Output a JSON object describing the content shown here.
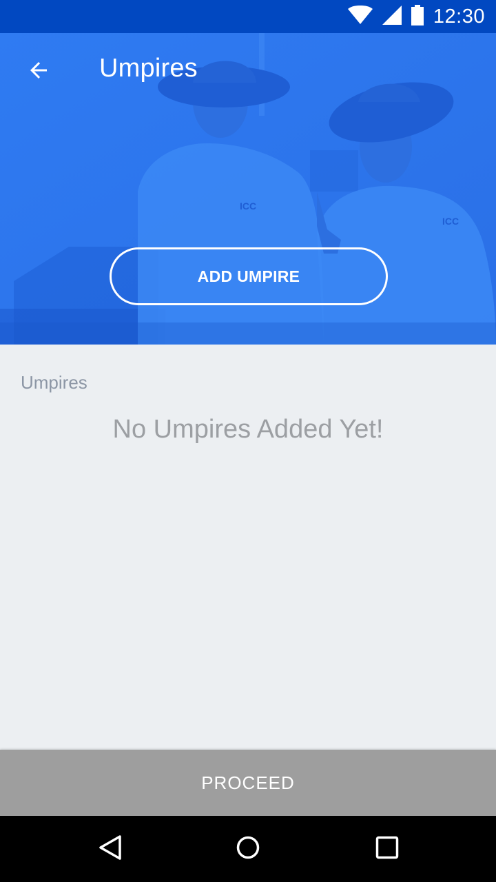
{
  "status_bar": {
    "time": "12:30",
    "icons": [
      "wifi-icon",
      "cell-signal-icon",
      "battery-icon"
    ],
    "background": "#0148c1"
  },
  "header": {
    "title": "Umpires",
    "back_icon": "arrow-back-icon",
    "add_button_label": "ADD UMPIRE",
    "overlay_color": "#2c78ef"
  },
  "content": {
    "section_label": "Umpires",
    "empty_message": "No Umpires Added Yet!"
  },
  "footer": {
    "proceed_label": "PROCEED",
    "proceed_color": "#9e9e9e"
  },
  "nav_bar": {
    "buttons": [
      "back-triangle-icon",
      "home-circle-icon",
      "recents-square-icon"
    ]
  }
}
